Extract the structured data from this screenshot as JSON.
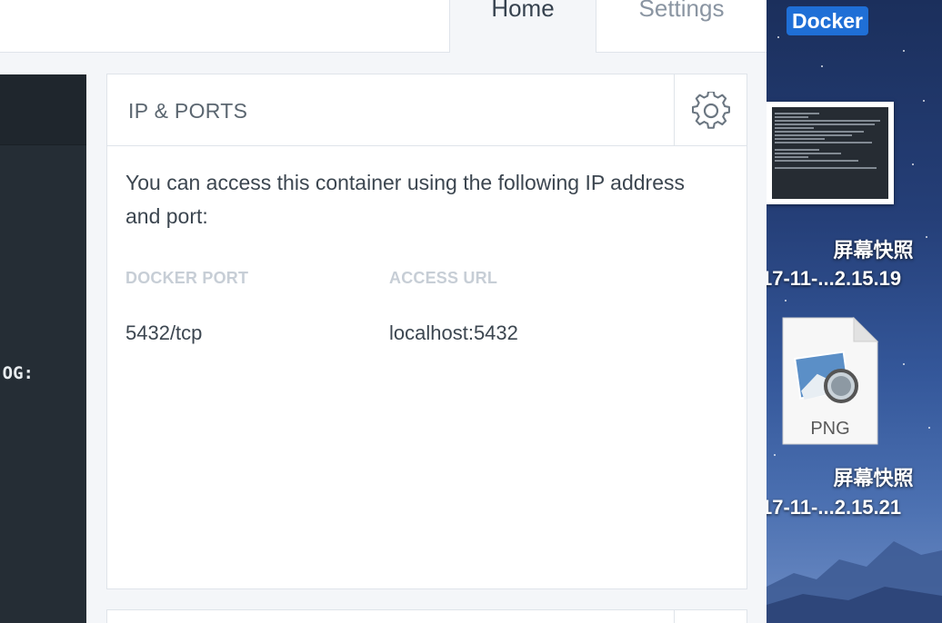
{
  "tabs": {
    "home": "Home",
    "settings": "Settings"
  },
  "log": {
    "visible_text": "OG:"
  },
  "ip_ports": {
    "title": "IP & PORTS",
    "description": "You can access this container using the following IP address and port:",
    "columns": {
      "docker_port": "DOCKER PORT",
      "access_url": "ACCESS URL"
    },
    "rows": [
      {
        "docker_port": "5432/tcp",
        "access_url": "localhost:5432"
      }
    ]
  },
  "desktop": {
    "docker_label": "Docker",
    "files": [
      {
        "name_line1": "屏幕快照",
        "name_line2": "17-11-...2.15.19"
      },
      {
        "name_line1": "屏幕快照",
        "name_line2": "17-11-...2.15.21",
        "type": "PNG"
      }
    ]
  }
}
